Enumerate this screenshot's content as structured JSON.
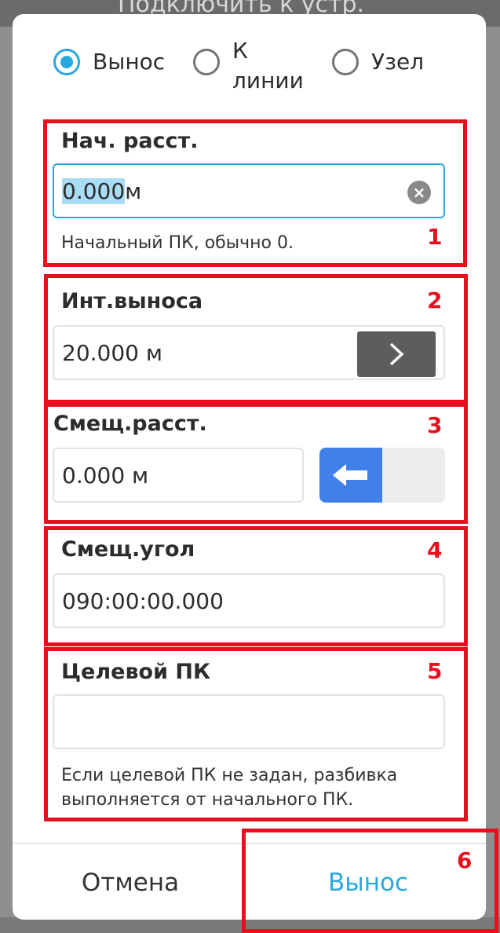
{
  "background": {
    "title": "Подключить к устр."
  },
  "mode": {
    "options": [
      {
        "label": "Вынос",
        "selected": true
      },
      {
        "label": "К\nлинии",
        "selected": false
      },
      {
        "label": "Узел",
        "selected": false
      }
    ],
    "option0": "Вынос",
    "option1_line1": "К",
    "option1_line2": "линии",
    "option2": "Узел"
  },
  "start_distance": {
    "title": "Нач. расст.",
    "value": "0.000",
    "unit": " м",
    "hint": "Начальный ПК, обычно 0."
  },
  "interval": {
    "title": "Инт.выноса",
    "value": "20.000 м"
  },
  "offset_distance": {
    "title": "Смещ.расст.",
    "value": "0.000 м",
    "direction": "left"
  },
  "offset_angle": {
    "title": "Смещ.угол",
    "value": "090:00:00.000"
  },
  "target_station": {
    "title": "Целевой ПК",
    "value": "",
    "hint_line1": "Если целевой ПК не задан, разбивка",
    "hint_line2": "выполняется от начального ПК."
  },
  "footer": {
    "cancel": "Отмена",
    "confirm": "Вынос"
  },
  "annotations": [
    "1",
    "2",
    "3",
    "4",
    "5",
    "6"
  ],
  "colors": {
    "accent": "#29a8e0",
    "toggle": "#4180e8",
    "annotation": "#e6101e"
  }
}
